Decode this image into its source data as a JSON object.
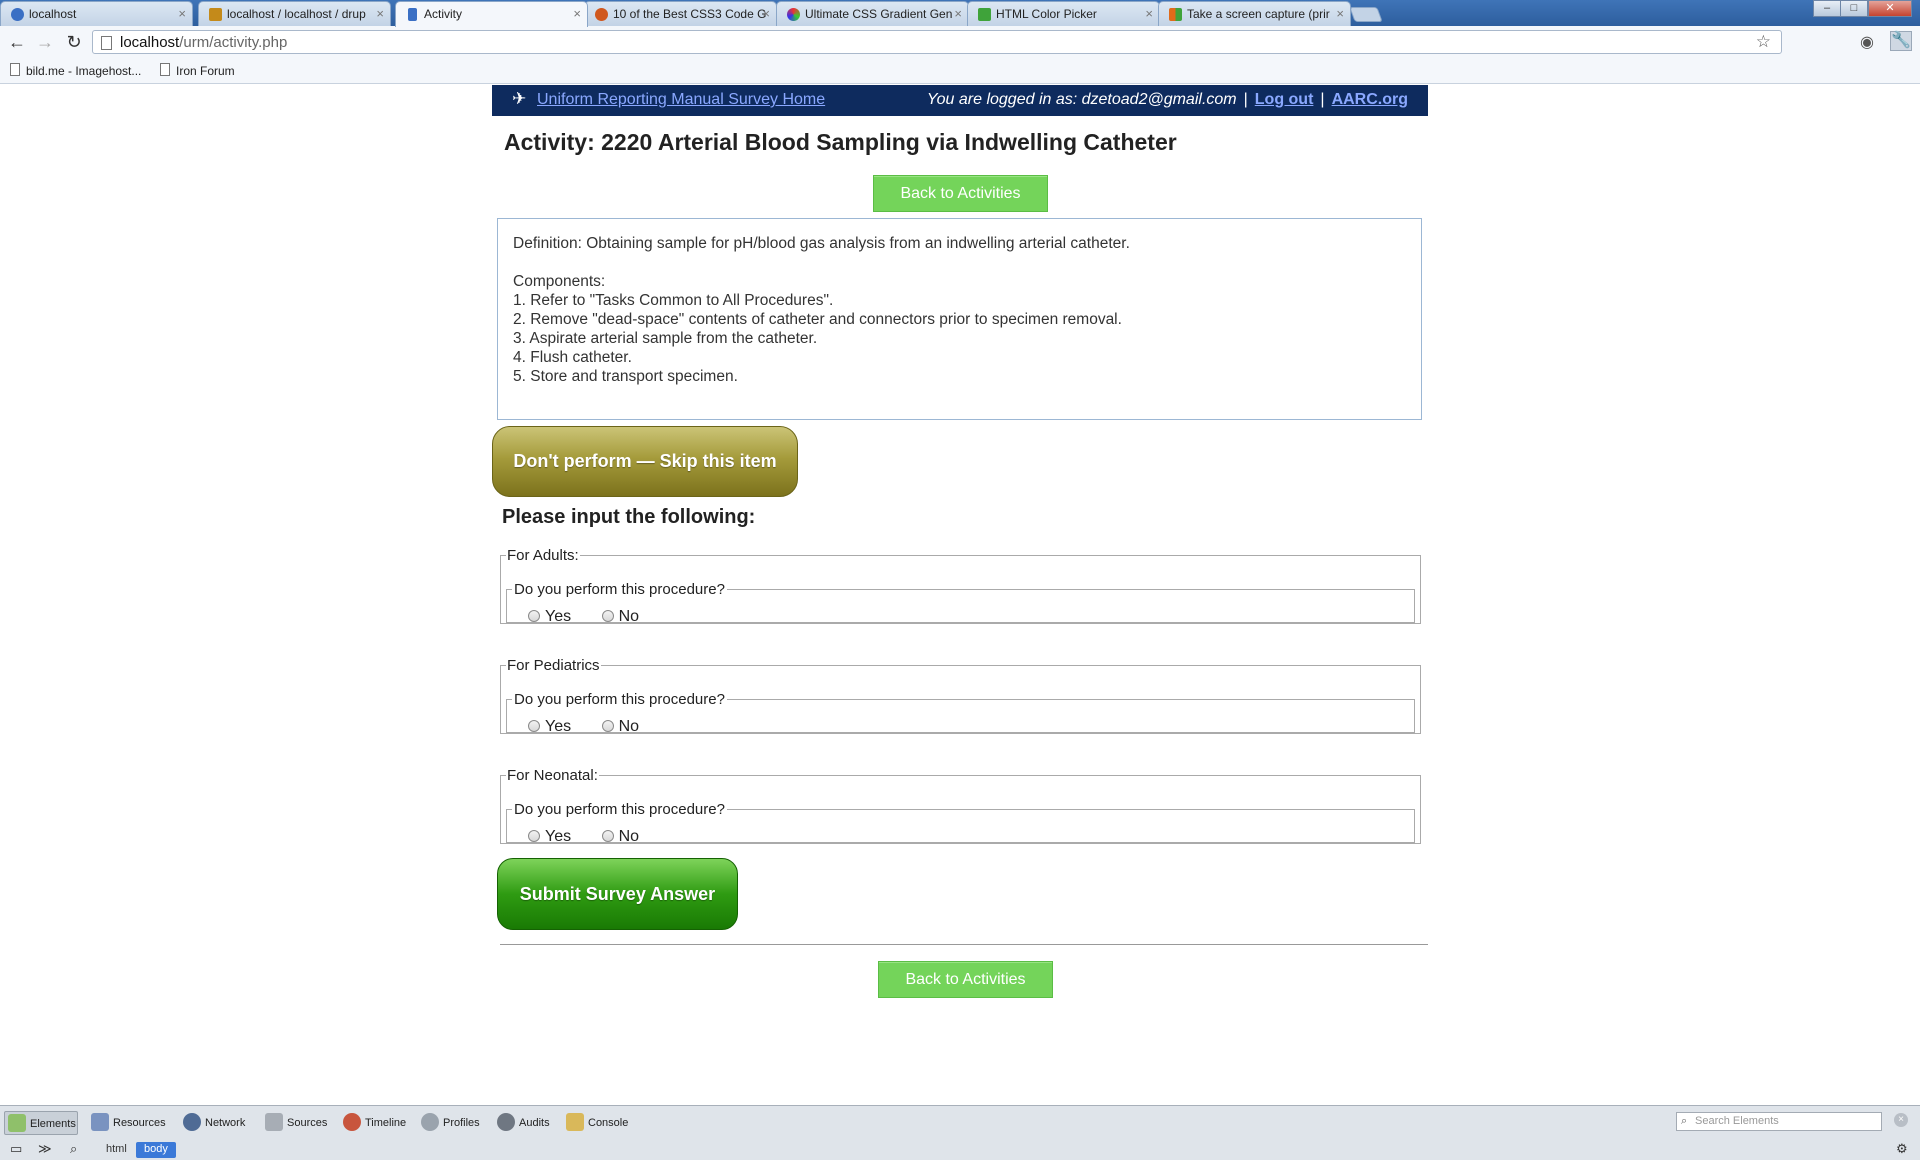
{
  "browser": {
    "tabs": [
      {
        "title": "localhost",
        "color": "#3a6fc4",
        "active": false
      },
      {
        "title": "localhost / localhost / drup",
        "color": "#c48a1a",
        "active": false
      },
      {
        "title": "Activity",
        "color": "#3a6fc4",
        "active": true
      },
      {
        "title": "10 of the Best CSS3 Code G",
        "color": "#d0581e",
        "active": false
      },
      {
        "title": "Ultimate CSS Gradient Gen",
        "color": "#8a3cc4",
        "active": false
      },
      {
        "title": "HTML Color Picker",
        "color": "#3fa33a",
        "active": false
      },
      {
        "title": "Take a screen capture (prir",
        "color": "#e06b1a",
        "active": false
      }
    ],
    "url_host": "localhost",
    "url_path": "/urm/activity.php",
    "bookmarks": [
      "bild.me - Imagehost...",
      "Iron Forum"
    ]
  },
  "header": {
    "home_link": "Uniform Reporting Manual Survey Home",
    "logged_in_text": "You are logged in as: dzetoad2@gmail.com",
    "separator": "|",
    "logout": "Log out",
    "aarc": "AARC.org"
  },
  "activity": {
    "title": "Activity: 2220 Arterial Blood Sampling via Indwelling Catheter",
    "definition": "Definition: Obtaining sample for pH/blood gas analysis from an indwelling arterial catheter.",
    "components_label": "Components:",
    "components": [
      "1. Refer to \"Tasks Common to All Procedures\".",
      "2. Remove \"dead-space\" contents of catheter and connectors prior to specimen removal.",
      "3. Aspirate arterial sample from the catheter.",
      "4. Flush catheter.",
      "5. Store and transport specimen."
    ]
  },
  "buttons": {
    "back_top": "Back to Activities",
    "skip": "Don't perform — Skip this item",
    "submit": "Submit Survey Answer",
    "back_bottom": "Back to Activities"
  },
  "form": {
    "heading": "Please input the following:",
    "groups": [
      {
        "legend": "For Adults:",
        "question": "Do you perform this procedure?",
        "yes": "Yes",
        "no": "No"
      },
      {
        "legend": "For Pediatrics",
        "question": "Do you perform this procedure?",
        "yes": "Yes",
        "no": "No"
      },
      {
        "legend": "For Neonatal:",
        "question": "Do you perform this procedure?",
        "yes": "Yes",
        "no": "No"
      }
    ]
  },
  "devtools": {
    "tabs": [
      "Elements",
      "Resources",
      "Network",
      "Sources",
      "Timeline",
      "Profiles",
      "Audits",
      "Console"
    ],
    "search_placeholder": "Search Elements",
    "crumbs": [
      "html",
      "body"
    ]
  }
}
